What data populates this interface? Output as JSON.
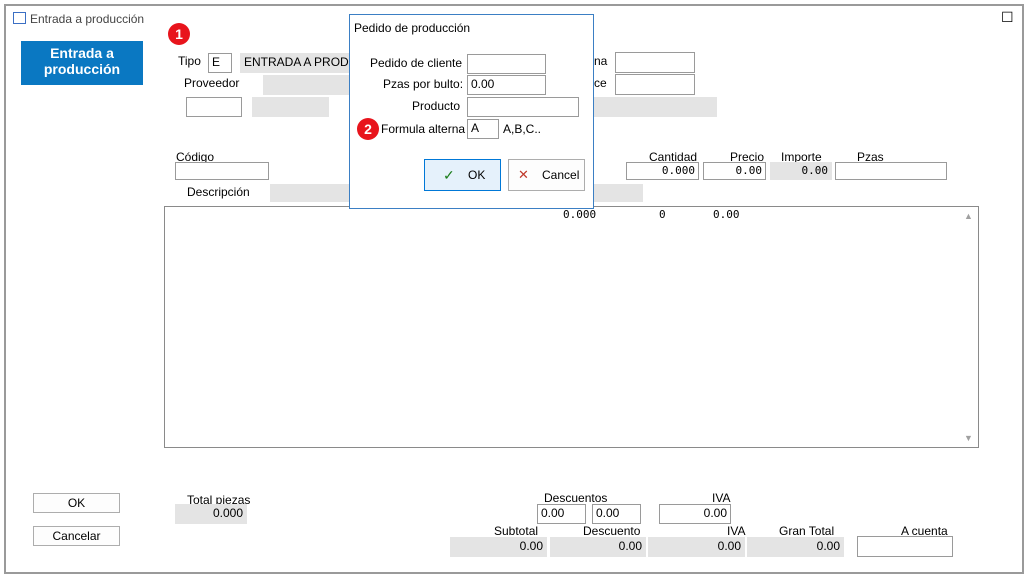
{
  "window": {
    "title": "Entrada a producción",
    "maximize_symbol": "☐"
  },
  "sidebar": {
    "button_label": "Entrada a producción",
    "accent": "#0a78c2"
  },
  "badges": {
    "one": "1",
    "two": "2"
  },
  "header": {
    "tipo_label": "Tipo",
    "tipo_code": "E",
    "tipo_desc": "ENTRADA A PRODUC",
    "proveedor_label": "Proveedor",
    "fecha_label_partial": "na",
    "ce_label_partial": "ce"
  },
  "line": {
    "codigo_label": "Código",
    "descripcion_label": "Descripción",
    "cantidad_label": "Cantidad",
    "cantidad_value": "0.000",
    "precio_label": "Precio",
    "precio_value": "0.00",
    "importe_label": "Importe",
    "importe_value": "0.00",
    "pzas_label": "Pzas"
  },
  "grid": {
    "row1": {
      "cantidad": "0.000",
      "pzas": "0",
      "importe": "0.00"
    },
    "scroll_up": "▲",
    "scroll_down": "▼"
  },
  "dialog": {
    "title": "Pedido de producción",
    "pedido_cliente_label": "Pedido de cliente",
    "pedido_cliente_value": "",
    "pzas_bulto_label": "Pzas por bulto:",
    "pzas_bulto_value": "0.00",
    "producto_label": "Producto",
    "producto_value": "",
    "formula_label": "Formula alterna",
    "formula_value": "A",
    "formula_hint": "A,B,C..",
    "ok_label": "OK",
    "ok_icon": "✓",
    "cancel_label": "Cancel",
    "cancel_icon": "✕"
  },
  "actions": {
    "ok_label": "OK",
    "cancel_label": "Cancelar"
  },
  "totals": {
    "total_piezas_label": "Total piezas",
    "total_piezas_value": "0.000",
    "descuentos_label": "Descuentos",
    "descuento1_value": "0.00",
    "descuento2_value": "0.00",
    "iva_top_label": "IVA",
    "iva_top_value": "0.00",
    "subtotal_label": "Subtotal",
    "subtotal_value": "0.00",
    "descuento_label": "Descuento",
    "descuento_value": "0.00",
    "iva_label": "IVA",
    "iva_value": "0.00",
    "gran_total_label": "Gran Total",
    "gran_total_value": "0.00",
    "a_cuenta_label": "A cuenta",
    "a_cuenta_value": ""
  }
}
